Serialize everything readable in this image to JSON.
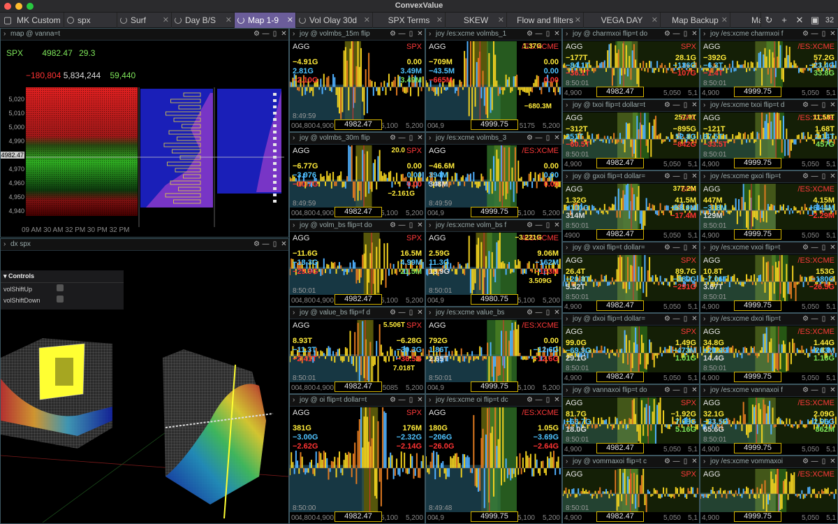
{
  "app_title": "ConvexValue",
  "tabs": [
    {
      "label": "MK Custom"
    },
    {
      "label": "spx"
    },
    {
      "label": "Surf"
    },
    {
      "label": "Day B/S"
    },
    {
      "label": "Map 1-9"
    },
    {
      "label": "Vol Olay 30d"
    },
    {
      "label": "SPX Terms"
    },
    {
      "label": "SKEW"
    },
    {
      "label": "Flow and filters"
    },
    {
      "label": "VEGA DAY"
    },
    {
      "label": "Map Backup"
    },
    {
      "label": "Ma"
    }
  ],
  "tab_count": "32",
  "map_panel": {
    "header": "map @ vanna=t",
    "symbol": "SPX",
    "price": "4982.47",
    "change": "29.3",
    "stat_red": "−180,804",
    "stat_white": "5,834,244",
    "stat_green": "59,440",
    "y_ticks": [
      "5,020",
      "5,010",
      "5,000",
      "4,990",
      "4982.47",
      "4,970",
      "4,960",
      "4,950",
      "4,940"
    ],
    "x_ticks": "09 AM 30 AM 32 PM 30 PM 32 PM"
  },
  "dx_panel": {
    "header": "dx spx",
    "controls_title": "Controls",
    "opt1": "volShiftUp",
    "opt2": "volShiftDown"
  },
  "mid_panels": [
    {
      "hdr": "joy @ volmbs_15m flip",
      "sym": "SPX",
      "l": [
        [
          "−4.91G",
          "y"
        ],
        [
          "2.81G",
          "b"
        ],
        [
          "−2.10G",
          "r"
        ]
      ],
      "rt": "",
      "r": [
        [
          "0.00",
          "y"
        ],
        [
          "3.49M",
          "b"
        ],
        [
          "3.49M",
          "g"
        ]
      ],
      "time": "8:49:59",
      "x": [
        "00",
        "4,800",
        "4,900"
      ],
      "x2": "5,100",
      "x3": "5,200",
      "price": "4982.47"
    },
    {
      "hdr": "joy /es:xcme volmbs_1",
      "sym": "/ES:XCME",
      "l": [
        [
          "−709M",
          "y"
        ],
        [
          "−43.5M",
          "b"
        ],
        [
          "−665M",
          "r"
        ]
      ],
      "rt": "1.37G",
      "r": [
        [
          "0.00",
          "y"
        ],
        [
          "0.00",
          "b"
        ],
        [
          "0.00",
          "r"
        ]
      ],
      "time": "",
      "x": [
        "00",
        "4,9"
      ],
      "x2": "5175",
      "x3": "5,200",
      "price": "4999.75",
      "extra": "−680.3M"
    },
    {
      "hdr": "joy @ volmbs_30m flip",
      "sym": "SPX",
      "l": [
        [
          "−6.77G",
          "y"
        ],
        [
          "−3.976",
          "b"
        ],
        [
          "−10.7G",
          "r"
        ]
      ],
      "rt": "20.0",
      "r": [
        [
          "0.00",
          "y"
        ],
        [
          "0.00",
          "b"
        ],
        [
          "0.00",
          "r"
        ]
      ],
      "time": "8:49:59",
      "x": [
        "00",
        "4,800",
        "4,900"
      ],
      "x2": "5,100",
      "x3": "5,200",
      "price": "4982.47",
      "extra": "−2.161G"
    },
    {
      "hdr": "joy /es:xcme volmbs_3",
      "sym": "/ES:XCME",
      "l": [
        [
          "−46.6M",
          "y"
        ],
        [
          "394M",
          "b"
        ],
        [
          "348M",
          "w"
        ]
      ],
      "rt": "",
      "r": [
        [
          "0.00",
          "y"
        ],
        [
          "0.00",
          "b"
        ],
        [
          "0.00",
          "r"
        ]
      ],
      "time": "8:49:59",
      "x": [
        "00",
        "4,9"
      ],
      "x2": "5,100",
      "x3": "5,200",
      "price": "4999.75"
    },
    {
      "hdr": "joy @ volm_bs flip=t do",
      "sym": "SPX",
      "l": [
        [
          "−11.6G",
          "y"
        ],
        [
          "−18.3G",
          "b"
        ],
        [
          "−29.9G",
          "r"
        ]
      ],
      "rt": "",
      "r": [
        [
          "16.5M",
          "y"
        ],
        [
          "4.99M",
          "b"
        ],
        [
          "21.5M",
          "g"
        ]
      ],
      "time": "8:50:01",
      "x": [
        "00",
        "4,800",
        "4,900"
      ],
      "x2": "5,100",
      "x3": "5,200",
      "price": "4982.47"
    },
    {
      "hdr": "joy /es:xcme volm_bs f",
      "sym": "/ES:XCME",
      "l": [
        [
          "2.59G",
          "y"
        ],
        [
          "11.3G",
          "b"
        ],
        [
          "13.9G",
          "w"
        ]
      ],
      "rt": "−3.221G",
      "r": [
        [
          "9.06M",
          "y"
        ],
        [
          "−162M",
          "b"
        ],
        [
          "−153M",
          "r"
        ]
      ],
      "time": "8:50:01",
      "x": [
        "00",
        "4,9"
      ],
      "x2": "5,100",
      "x3": "5,200",
      "price": "4980.75",
      "extra": "3.509G"
    },
    {
      "hdr": "joy @ value_bs flip=f d",
      "sym": "SPX",
      "l": [
        [
          "8.93T",
          "y"
        ],
        [
          "−11.3T",
          "b"
        ],
        [
          "−2.41T",
          "r"
        ]
      ],
      "rt": "5.506T",
      "r": [
        [
          "−6.28G",
          "y"
        ],
        [
          "−30.3G",
          "b"
        ],
        [
          "−36.5G",
          "r"
        ]
      ],
      "time": "8:50:01",
      "x": [
        "00",
        "4,800",
        "4,900"
      ],
      "x2": "5085",
      "x3": "5,200",
      "price": "4982.47",
      "extra": "7.018T"
    },
    {
      "hdr": "joy /es:xcme value_bs",
      "sym": "/ES:XCME",
      "l": [
        [
          "792G",
          "y"
        ],
        [
          "1.86T",
          "b"
        ],
        [
          "2.65T",
          "w"
        ]
      ],
      "rt": "",
      "r": [
        [
          "0.00",
          "y"
        ],
        [
          "−12.6G",
          "b"
        ],
        [
          "−12.6G",
          "r"
        ]
      ],
      "time": "8:50:01",
      "x": [
        "00",
        "4,9"
      ],
      "x2": "5,100",
      "x3": "5,200",
      "price": "4999.75"
    },
    {
      "hdr": "joy @ oi flip=t dollar=t",
      "sym": "SPX",
      "l": [
        [
          "381G",
          "y"
        ],
        [
          "−3.00G",
          "b"
        ],
        [
          "−2.62G",
          "r"
        ]
      ],
      "rt": "",
      "r": [
        [
          "176M",
          "y"
        ],
        [
          "−2.32G",
          "b"
        ],
        [
          "−2.14G",
          "r"
        ]
      ],
      "time": "8:50:00",
      "x": [
        "00",
        "4,800",
        "4,900"
      ],
      "x2": "5,100",
      "x3": "5,200",
      "price": "4982.47"
    },
    {
      "hdr": "joy /es:xcme oi flip=t dc",
      "sym": "/ES:XCME",
      "l": [
        [
          "180G",
          "y"
        ],
        [
          "−206G",
          "b"
        ],
        [
          "−26.0G",
          "r"
        ]
      ],
      "rt": "",
      "r": [
        [
          "1.05G",
          "y"
        ],
        [
          "−3.69G",
          "b"
        ],
        [
          "−2.64G",
          "r"
        ]
      ],
      "time": "8:49:48",
      "x": [
        "00",
        "4,9"
      ],
      "x2": "5,100",
      "x3": "5,200",
      "price": "4999.75"
    }
  ],
  "right_panels": [
    {
      "hdr": "joy @ charmxoi flip=t do",
      "sym": "SPX",
      "l": [
        [
          "−177T",
          "y"
        ],
        [
          "−84.1T",
          "b"
        ],
        [
          "−36.1T",
          "r"
        ]
      ],
      "r": [
        [
          "28.1G",
          "y"
        ],
        [
          "−136G",
          "b"
        ],
        [
          "−107G",
          "r"
        ]
      ],
      "time": "8:50:01",
      "x": [
        "4,900"
      ],
      "x2": "5,050",
      "x3": "5,1",
      "price": "4982.47"
    },
    {
      "hdr": "joy /es:xcme charmxoi f",
      "sym": "/ES:XCME",
      "l": [
        [
          "−392G",
          "y"
        ],
        [
          "−6.3T",
          "b"
        ],
        [
          "−1.4T",
          "r"
        ]
      ],
      "r": [
        [
          "57.2G",
          "y"
        ],
        [
          "−23.4G",
          "b"
        ],
        [
          "33.8G",
          "g"
        ]
      ],
      "time": "8:50:01",
      "x": [
        "4,900"
      ],
      "x2": "5,050",
      "x3": "5,1",
      "price": "4999.75"
    },
    {
      "hdr": "joy @ txoi flip=t dollar=t",
      "sym": "SPX",
      "l": [
        [
          "−312T",
          "y"
        ],
        [
          "251T",
          "b"
        ],
        [
          "−60.5T",
          "r"
        ]
      ],
      "r": [
        [
          "−895G",
          "y"
        ],
        [
          "52.8G",
          "b"
        ],
        [
          "−842G",
          "r"
        ]
      ],
      "time": "8:50:01",
      "x": [
        "4,900"
      ],
      "x2": "5,050",
      "x3": "5,1",
      "price": "4982.47",
      "rt": "257.9T"
    },
    {
      "hdr": "joy /es:xcme txoi flip=t d",
      "sym": "/ES:XCME",
      "l": [
        [
          "−121T",
          "y"
        ],
        [
          "87.5T",
          "b"
        ],
        [
          "−33.5T",
          "r"
        ]
      ],
      "r": [
        [
          "1.68T",
          "y"
        ],
        [
          "2.14T",
          "b"
        ],
        [
          "457G",
          "g"
        ]
      ],
      "time": "8:50:01",
      "x": [
        "4,900"
      ],
      "x2": "5,050",
      "x3": "5,1",
      "price": "4999.75",
      "rt": "11.58T"
    },
    {
      "hdr": "joy @ gxoi flip=t dollar=",
      "sym": "SPX",
      "l": [
        [
          "1.32G",
          "y"
        ],
        [
          "−100G",
          "b"
        ],
        [
          "314M",
          "w"
        ]
      ],
      "r": [
        [
          "41.5M",
          "y"
        ],
        [
          "−58.9M",
          "b"
        ],
        [
          "−17.4M",
          "r"
        ]
      ],
      "time": "8:50:01",
      "x": [
        "4900"
      ],
      "x2": "5,050",
      "x3": "5,1",
      "price": "4982.47",
      "rt": "377.2M"
    },
    {
      "hdr": "joy /es:xcme gxoi flip=t",
      "sym": "/ES:XCME",
      "l": [
        [
          "447M",
          "y"
        ],
        [
          "−318M",
          "b"
        ],
        [
          "129M",
          "w"
        ]
      ],
      "r": [
        [
          "4.15M",
          "y"
        ],
        [
          "−6.44M",
          "b"
        ],
        [
          "−2.29M",
          "r"
        ]
      ],
      "time": "8:50:01",
      "x": [
        "4,900"
      ],
      "x2": "5,050",
      "x3": "5,1",
      "price": "4999.75"
    },
    {
      "hdr": "joy @ vxoi flip=t dollar=",
      "sym": "SPX",
      "l": [
        [
          "26.4T",
          "y"
        ],
        [
          "−20.8T",
          "b"
        ],
        [
          "5.52T",
          "w"
        ]
      ],
      "r": [
        [
          "89.7G",
          "y"
        ],
        [
          "−380G",
          "b"
        ],
        [
          "−291G",
          "r"
        ]
      ],
      "time": "8:50:01",
      "x": [
        "4,900"
      ],
      "x2": "5,050",
      "x3": "5,1",
      "price": "4982.47"
    },
    {
      "hdr": "joy /es:xcme vxoi flip=t",
      "sym": "/ES:XCME",
      "l": [
        [
          "10.8T",
          "y"
        ],
        [
          "−7.06T",
          "b"
        ],
        [
          "3.67T",
          "w"
        ]
      ],
      "r": [
        [
          "153G",
          "y"
        ],
        [
          "−180G",
          "b"
        ],
        [
          "−26.5G",
          "r"
        ]
      ],
      "time": "8:50:01",
      "x": [
        "4,900"
      ],
      "x2": "5,050",
      "x3": "5,1",
      "price": "4999.75"
    },
    {
      "hdr": "joy @ dxoi flip=t dollar=",
      "sym": "SPX",
      "l": [
        [
          "99.0G",
          "y"
        ],
        [
          "−69.9G",
          "b"
        ],
        [
          "29.1G",
          "w"
        ]
      ],
      "r": [
        [
          "1.49G",
          "y"
        ],
        [
          "−473M",
          "b"
        ],
        [
          "1.01G",
          "g"
        ]
      ],
      "time": "8:50:01",
      "x": [
        "4,900"
      ],
      "x2": "5,050",
      "x3": "5,1",
      "price": "4982.47"
    },
    {
      "hdr": "joy /es:xcme dxoi flip=t",
      "sym": "/ES:XCME",
      "l": [
        [
          "34.8G",
          "y"
        ],
        [
          "−20.4G",
          "b"
        ],
        [
          "14.4G",
          "w"
        ]
      ],
      "r": [
        [
          "1.44G",
          "y"
        ],
        [
          "−263M",
          "b"
        ],
        [
          "1.18G",
          "g"
        ]
      ],
      "time": "8:50:01",
      "x": [
        "4,900"
      ],
      "x2": "5,050",
      "x3": "5,1",
      "price": "4999.75"
    },
    {
      "hdr": "joy @ vannaxoi flip=t do",
      "sym": "SPX",
      "l": [
        [
          "81.7G",
          "y"
        ],
        [
          "−63.7G",
          "b"
        ],
        [
          "18.0G",
          "w"
        ]
      ],
      "r": [
        [
          "−1.92G",
          "y"
        ],
        [
          "7.08G",
          "b"
        ],
        [
          "5.16G",
          "g"
        ]
      ],
      "time": "8:50:01",
      "x": [
        "4,900"
      ],
      "x2": "5,050",
      "x3": "5,1",
      "price": "4982.47"
    },
    {
      "hdr": "joy /es:xcme vannaxoi f",
      "sym": "/ES:XCME",
      "l": [
        [
          "32.1G",
          "y"
        ],
        [
          "−33.5G",
          "b"
        ],
        [
          "65.6G",
          "w"
        ]
      ],
      "r": [
        [
          "2.09G",
          "y"
        ],
        [
          "2.96G",
          "b"
        ],
        [
          "862M",
          "g"
        ]
      ],
      "time": "8:50:01",
      "x": [
        "4,900"
      ],
      "x2": "5,050",
      "x3": "5,1",
      "price": "4999.75"
    },
    {
      "hdr": "joy @ vommaxoi flip=t c",
      "sym": "SPX",
      "l": [],
      "r": [],
      "time": "8:50:01",
      "x": [
        "4,900"
      ],
      "x2": "5,050",
      "x3": "5,1",
      "price": "4982.47"
    },
    {
      "hdr": "joy /es:xcme vommaxoi",
      "sym": "/ES:XCME",
      "l": [],
      "r": [],
      "time": "",
      "x": [
        "4,900"
      ],
      "x2": "5,050",
      "x3": "5,1",
      "price": "4999.75"
    }
  ]
}
